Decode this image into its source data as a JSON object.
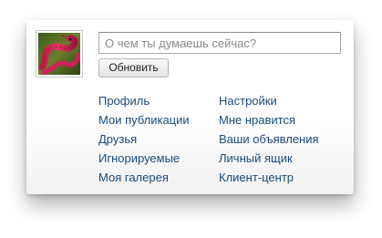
{
  "status": {
    "placeholder": "О чем ты думаешь сейчас?",
    "value": ""
  },
  "update_button_label": "Обновить",
  "avatar": {
    "icon": "snake-photo-icon"
  },
  "links": {
    "left": [
      "Профиль",
      "Мои публикации",
      "Друзья",
      "Игнорируемые",
      "Моя галерея"
    ],
    "right": [
      "Настройки",
      "Мне нравится",
      "Ваши объявления",
      "Личный ящик",
      "Клиент-центр"
    ]
  },
  "colors": {
    "link": "#1a4a7a",
    "card_background": "#ffffff"
  }
}
